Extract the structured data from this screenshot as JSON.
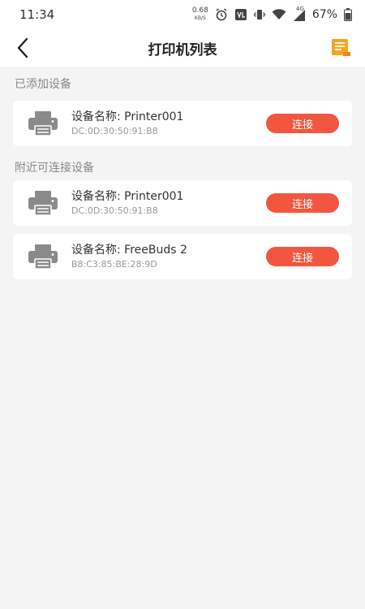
{
  "status_bar": {
    "time": "11:34",
    "net_speed": "0.68",
    "net_speed_unit": "KB/S",
    "network_type": "4G",
    "battery": "67%"
  },
  "nav": {
    "title": "打印机列表"
  },
  "sections": {
    "added_title": "已添加设备",
    "nearby_title": "附近可连接设备"
  },
  "added_devices": [
    {
      "name": "设备名称: Printer001",
      "mac": "DC:0D:30:50:91:B8",
      "button": "连接"
    }
  ],
  "nearby_devices": [
    {
      "name": "设备名称: Printer001",
      "mac": "DC:0D:30:50:91:B8",
      "button": "连接"
    },
    {
      "name": "设备名称: FreeBuds 2",
      "mac": "B8:C3:85:BE:28:9D",
      "button": "连接"
    }
  ],
  "colors": {
    "accent": "#f2563f",
    "doc_icon": "#f5a623"
  }
}
